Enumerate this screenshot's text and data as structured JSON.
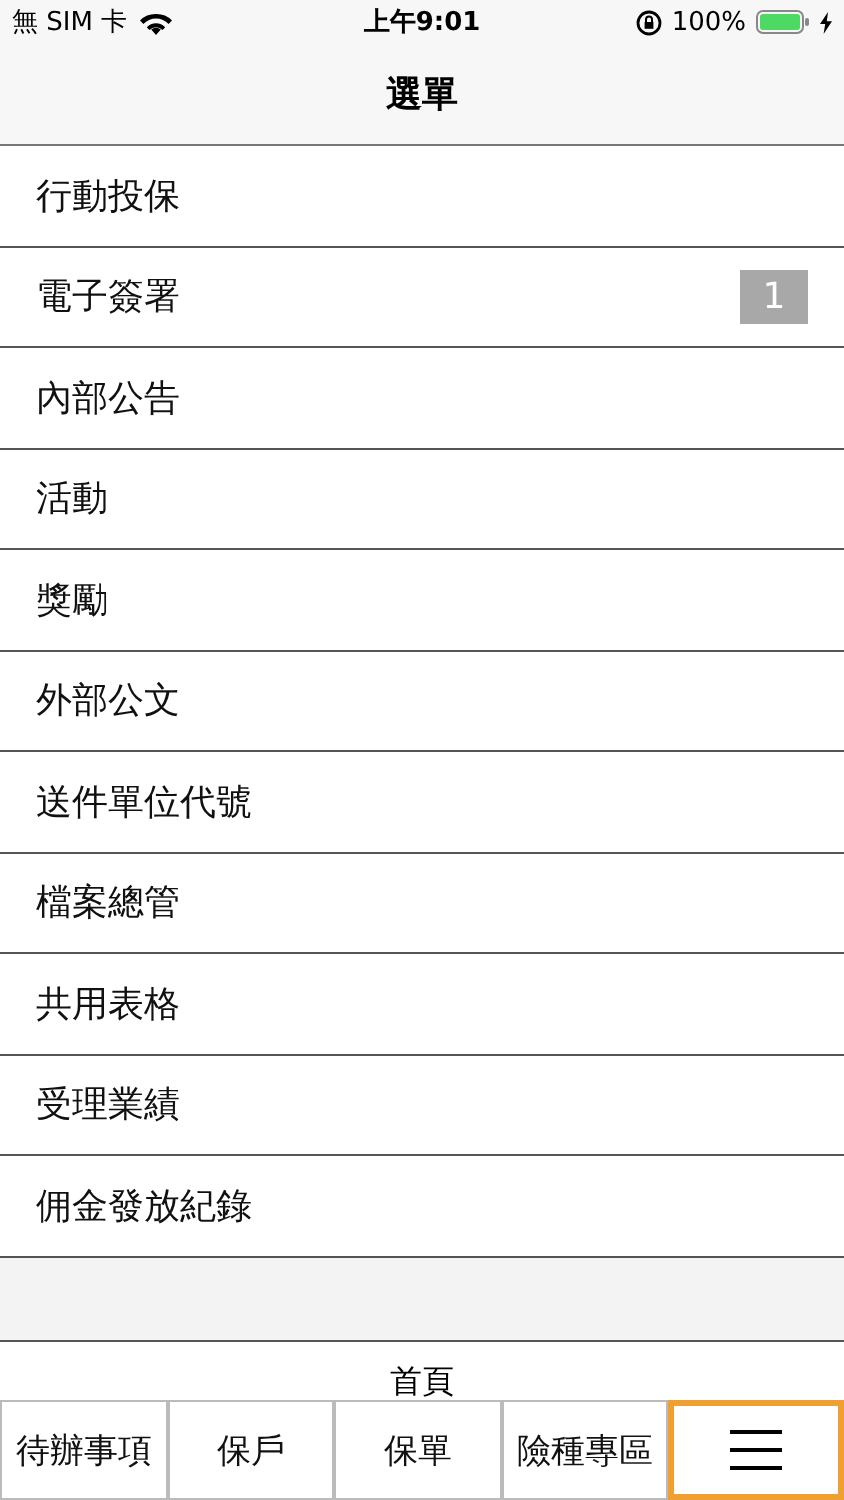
{
  "status_bar": {
    "carrier": "無 SIM 卡",
    "time": "上午9:01",
    "battery": "100%"
  },
  "nav_bar": {
    "title": "選單"
  },
  "menu_items": [
    {
      "label": "行動投保"
    },
    {
      "label": "電子簽署",
      "badge": "1"
    },
    {
      "label": "內部公告"
    },
    {
      "label": "活動"
    },
    {
      "label": "獎勵"
    },
    {
      "label": "外部公文"
    },
    {
      "label": "送件單位代號"
    },
    {
      "label": "檔案總管"
    },
    {
      "label": "共用表格"
    },
    {
      "label": "受理業績"
    },
    {
      "label": "佣金發放紀錄"
    }
  ],
  "home_label": "首頁",
  "tabs": [
    {
      "kind": "text",
      "label": "待辦事項",
      "selected": false
    },
    {
      "kind": "text",
      "label": "保戶",
      "selected": false
    },
    {
      "kind": "text",
      "label": "保單",
      "selected": false
    },
    {
      "kind": "text",
      "label": "險種專區",
      "selected": false
    },
    {
      "kind": "menu",
      "selected": true
    }
  ]
}
